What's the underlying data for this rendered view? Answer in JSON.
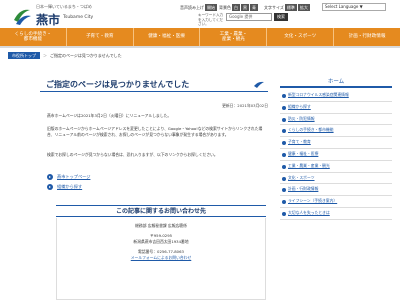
{
  "header": {
    "tagline": "日本一輝いているまち・つばめ",
    "city_name": "燕市",
    "city_roman": "Tsubame City",
    "tools": {
      "audio_label": "音声読み上げ",
      "audio_button": "開始",
      "color_label": "背景色",
      "color_buttons": [
        "白",
        "黒",
        "青"
      ],
      "size_label": "文字サイズ",
      "size_buttons": [
        "標準",
        "拡大"
      ]
    },
    "language_select": "Select Language ▼",
    "keyword_label": "キーワード入力を入力してください。",
    "search_placeholder": "Google 提供",
    "search_button": "検索"
  },
  "nav": {
    "items": [
      "くらしの手続き・\n都市機能",
      "子育て・教育",
      "健康・福祉・医療",
      "工業・農業・\n産業・観光",
      "文化・スポーツ",
      "計画・行財政情報"
    ]
  },
  "breadcrumb": {
    "home": "市役所トップ",
    "separator": "＞",
    "current": "ご指定のページは見つかりませんでした"
  },
  "main": {
    "title": "ご指定のページは見つかりませんでした",
    "updated": "更新日：2021年03月02日",
    "paragraphs": [
      "燕市ホームページは2021年3月2日（火曜日）にリニューアルしました。",
      "旧版のホームページからホームページアドレスを変更したことにより、Google・Yahoo!などの検索サイトからリンクされた場合、リニューアル前のページが検索され、お探しのページが見つからない事象が発生する場合があります。",
      "検索でお探しのページが見つからない場合は、恐れ入りますが、以下のリンクからお探しください。"
    ],
    "links": [
      "燕市トップページ",
      "組織から探す"
    ],
    "contact": {
      "heading": "この記事に関するお問い合わせ先",
      "dept": "総務部 広報秘書課 広報広聴係",
      "postal": "〒959-0295",
      "address": "新潟県燕市吉田西太田1934番地",
      "phone": "電話番号：0256-77-8063",
      "mail_link": "メールフォームによるお問い合わせ"
    }
  },
  "side": {
    "title": "ホーム",
    "items": [
      "新型コロナウイルス感染症関連情報",
      "組織から探す",
      "防災・防犯情報",
      "くらしの手続き・都市機能",
      "子育て・教育",
      "健康・福祉・医療",
      "工業・農業・産業・観光",
      "文化・スポーツ",
      "計画・行財政情報",
      "ライフシーン（手続き案内）",
      "大切な人を失ったときは"
    ]
  },
  "colors": {
    "nav_orange": "#e58a1f",
    "brand_blue": "#1f5aa8",
    "title_navy": "#1b3a6b"
  }
}
